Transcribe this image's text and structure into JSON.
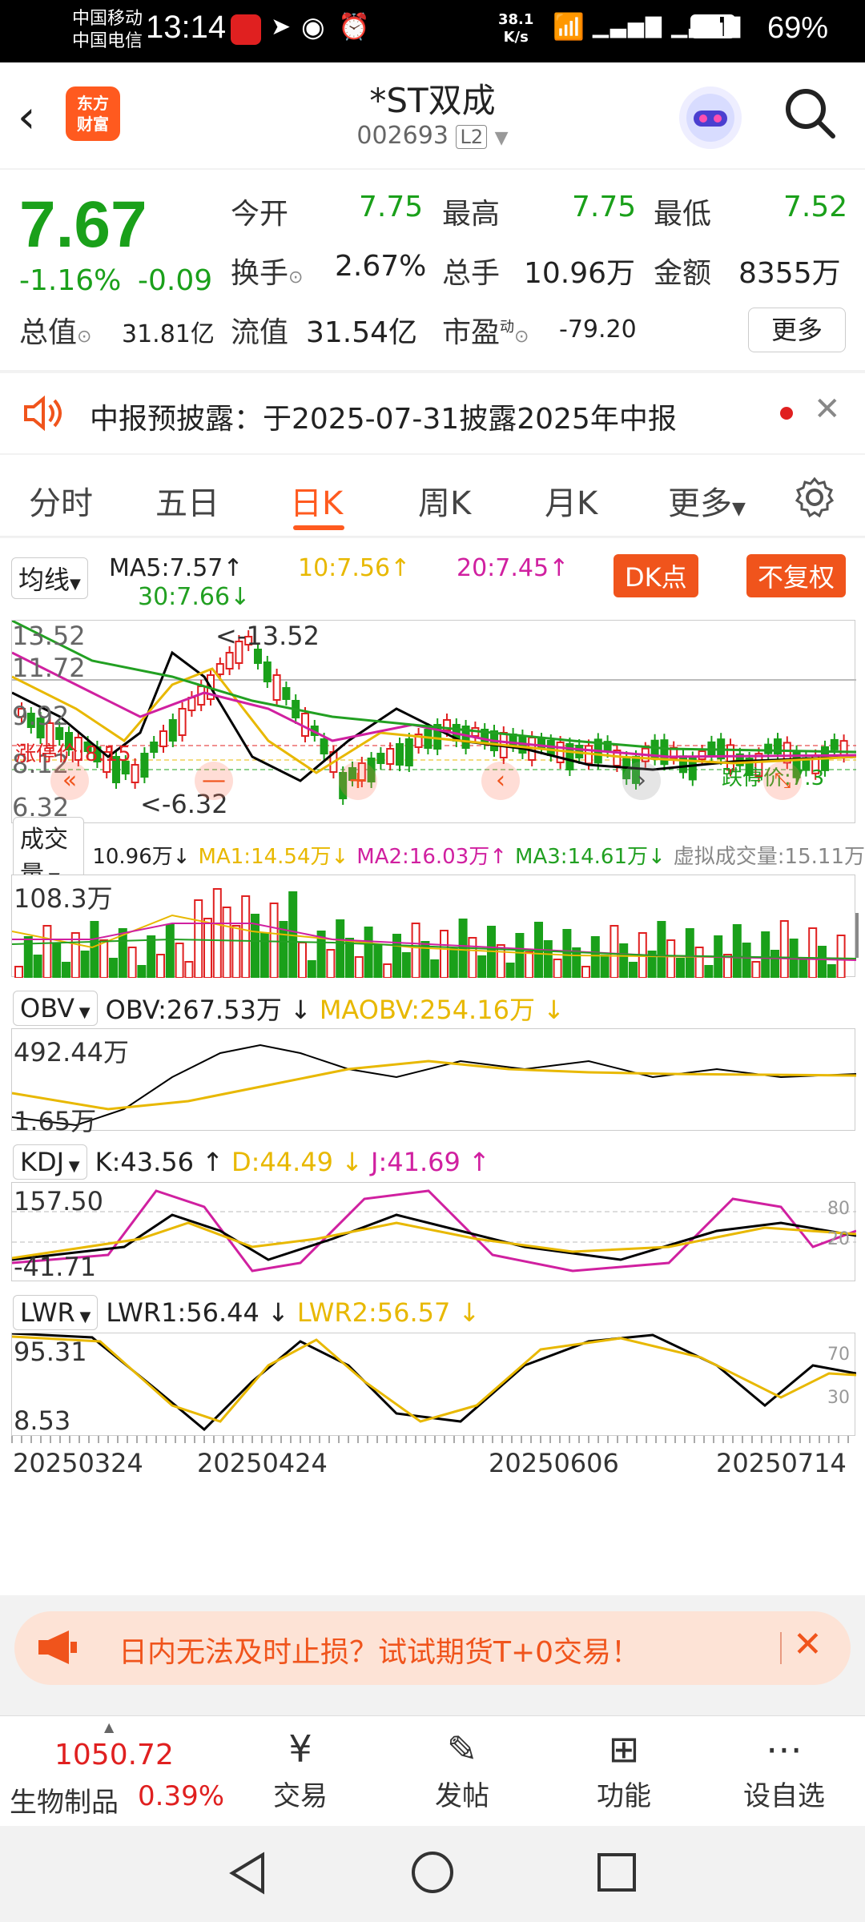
{
  "status_bar": {
    "carrier1": "中国移动",
    "carrier2": "中国电信",
    "time": "13:14",
    "net_speed": "38.1",
    "net_unit": "K/s",
    "battery": "69%"
  },
  "header": {
    "logo_line1": "东方",
    "logo_line2": "财富",
    "stock_name": "*ST双成",
    "stock_code": "002693",
    "level": "L2"
  },
  "quote": {
    "price": "7.67",
    "change_pct": "-1.16%",
    "change": "-0.09",
    "open_label": "今开",
    "open": "7.75",
    "high_label": "最高",
    "high": "7.75",
    "low_label": "最低",
    "low": "7.52",
    "turnover_label": "换手",
    "turnover": "2.67%",
    "volume_label": "总手",
    "volume": "10.96万",
    "amount_label": "金额",
    "amount": "8355万",
    "mcap_label": "总值",
    "mcap": "31.81亿",
    "float_label": "流值",
    "float_cap": "31.54亿",
    "pe_label": "市盈",
    "pe_sup": "动",
    "pe": "-79.20",
    "more_label": "更多"
  },
  "notice": {
    "text": "中报预披露：于2025-07-31披露2025年中报"
  },
  "tabs": [
    "分时",
    "五日",
    "日K",
    "周K",
    "月K",
    "更多"
  ],
  "kline": {
    "ma_select": "均线",
    "ma5": "MA5:7.57↑",
    "ma10": "10:7.56↑",
    "ma20": "20:7.45↑",
    "ma30": "30:7.66↓",
    "dk_btn": "DK点",
    "fq_btn": "不复权",
    "y_high": "13.52",
    "y_2": "11.72",
    "y_3": "9.92",
    "y_4": "8.12",
    "y_low": "6.32",
    "max_label": "<-13.52",
    "min_label": "<-6.32",
    "limit_up": "涨停价:8.15",
    "limit_down": "跌停价:7.3",
    "colors": {
      "ma5": "#000000",
      "ma10": "#e8b800",
      "ma20": "#d020a0",
      "ma30": "#22a022",
      "up": "#e02020",
      "down": "#1aa01a"
    }
  },
  "volume": {
    "select": "成交量",
    "v": "10.96万↓",
    "ma1": "MA1:14.54万↓",
    "ma2": "MA2:16.03万↑",
    "ma3": "MA3:14.61万↓",
    "virtual": "虚拟成交量:15.11万",
    "y_max": "108.3万"
  },
  "obv": {
    "select": "OBV",
    "obv": "OBV:267.53万 ↓",
    "maobv": "MAOBV:254.16万 ↓",
    "y_max": "492.44万",
    "y_min": "1.65万"
  },
  "kdj": {
    "select": "KDJ",
    "k": "K:43.56 ↑",
    "d": "D:44.49 ↓",
    "j": "J:41.69 ↑",
    "y_max": "157.50",
    "y_min": "-41.71",
    "ref_high": "80",
    "ref_low": "20"
  },
  "lwr": {
    "select": "LWR",
    "lwr1": "LWR1:56.44 ↓",
    "lwr2": "LWR2:56.57 ↓",
    "y_max": "95.31",
    "y_min": "8.53",
    "ref_high": "70",
    "ref_low": "30"
  },
  "dates": [
    "20250324",
    "20250424",
    "20250606",
    "20250714"
  ],
  "promo": {
    "text": "日内无法及时止损？试试期货T+0交易！"
  },
  "bottom_nav": {
    "index_value": "1050.72",
    "index_name": "生物制品",
    "index_change": "0.39%",
    "items": [
      "交易",
      "发帖",
      "功能",
      "设自选"
    ]
  }
}
